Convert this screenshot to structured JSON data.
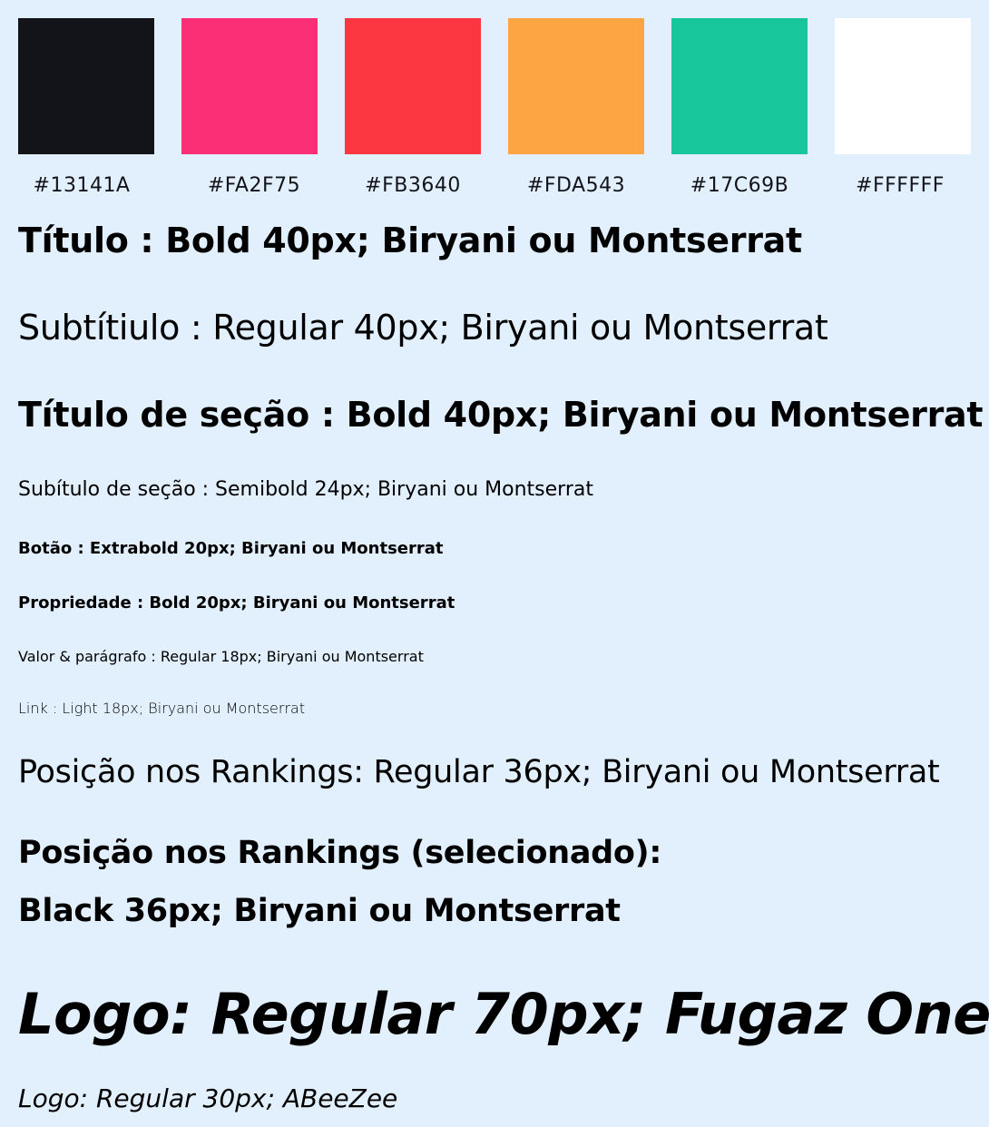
{
  "palette": [
    {
      "color": "#13141A",
      "label": "#13141A"
    },
    {
      "color": "#FA2F75",
      "label": "#FA2F75"
    },
    {
      "color": "#FB3640",
      "label": "#FB3640"
    },
    {
      "color": "#FDA543",
      "label": "#FDA543"
    },
    {
      "color": "#17C69B",
      "label": "#17C69B"
    },
    {
      "color": "#FFFFFF",
      "label": "#FFFFFF"
    }
  ],
  "typography": {
    "titulo": "Título : Bold 40px; Biryani ou Montserrat",
    "subtitulo": "Subtítiulo : Regular 40px; Biryani ou Montserrat",
    "titulo_secao": "Título de seção : Bold 40px; Biryani ou Montserrat",
    "subtitulo_secao": "Subítulo de seção : Semibold 24px; Biryani ou Montserrat",
    "botao": "Botão : Extrabold 20px; Biryani ou Montserrat",
    "propriedade": "Propriedade : Bold 20px; Biryani ou Montserrat",
    "valor_paragrafo": "Valor & parágrafo : Regular 18px; Biryani ou Montserrat",
    "link": "Link : Light 18px; Biryani ou Montserrat",
    "ranking": "Posição nos Rankings: Regular 36px; Biryani ou Montserrat",
    "ranking_selecionado_1": "Posição nos Rankings (selecionado):",
    "ranking_selecionado_2": "Black 36px; Biryani ou Montserrat",
    "logo_grande": "Logo: Regular 70px; Fugaz One",
    "logo_pequeno": "Logo: Regular 30px; ABeeZee"
  }
}
